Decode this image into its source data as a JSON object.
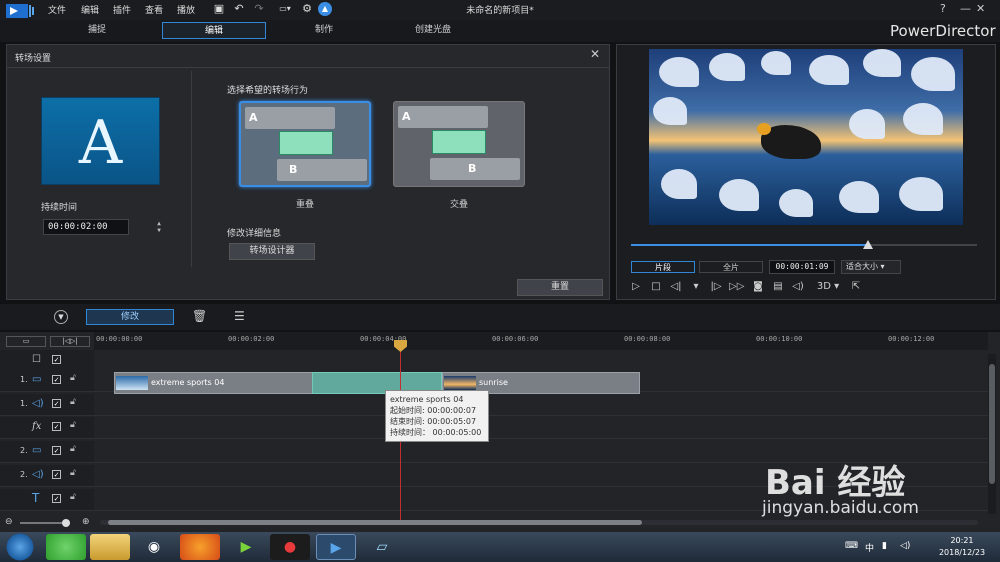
{
  "menu": [
    "文件",
    "编辑",
    "插件",
    "查看",
    "播放"
  ],
  "window_title": "未命名的新项目*",
  "window_controls": [
    "?",
    "—",
    "❐",
    "✕"
  ],
  "mode_tabs": [
    {
      "label": "捕捉",
      "active": false
    },
    {
      "label": "编辑",
      "active": true
    },
    {
      "label": "制作",
      "active": false
    },
    {
      "label": "创建光盘",
      "active": false
    }
  ],
  "brand": "PowerDirector",
  "transition_panel": {
    "title": "转场设置",
    "thumb_letter": "A",
    "duration_label": "持续时间",
    "duration_value": "00:00:02:00",
    "behavior_label": "选择希望的转场行为",
    "modes": [
      {
        "caption": "重叠",
        "a": "A",
        "b": "B",
        "selected": true
      },
      {
        "caption": "交叠",
        "a": "A",
        "b": "B",
        "selected": false
      }
    ],
    "details_label": "修改详细信息",
    "designer_button": "转场设计器",
    "reset_button": "重置"
  },
  "player": {
    "tab_clip": "片段",
    "tab_full": "全片",
    "timecode": "00:00:01:09",
    "fit": "适合大小",
    "three_d": "3D",
    "progress": 0.68
  },
  "edit_toolbar": {
    "modify_label": "修改"
  },
  "ruler_ticks": [
    "00:00:00:00",
    "00:00:02:00",
    "00:00:04:00",
    "00:00:06:00",
    "00:00:08:00",
    "00:00:10:00",
    "00:00:12:00"
  ],
  "tracks": [
    {
      "num": "",
      "icon": "☐"
    },
    {
      "num": "1.",
      "icon": "▭"
    },
    {
      "num": "1.",
      "icon": "◁)"
    },
    {
      "num": "",
      "icon": "fx"
    },
    {
      "num": "2.",
      "icon": "▭"
    },
    {
      "num": "2.",
      "icon": "◁)"
    },
    {
      "num": "",
      "icon": "T"
    }
  ],
  "clips": {
    "clip1": "extreme sports 04",
    "clip2": "sunrise"
  },
  "tooltip": {
    "name": "extreme sports 04",
    "start": "起始时间: 00:00:00:07",
    "end": "结束时间: 00:00:05:07",
    "duration": "持续时间： 00:00:05:00"
  },
  "taskbar": {
    "time": "20:21",
    "date": "2018/12/23",
    "tray_lang": "中"
  },
  "watermark": {
    "logo": "Bai 经验",
    "url": "jingyan.baidu.com"
  }
}
